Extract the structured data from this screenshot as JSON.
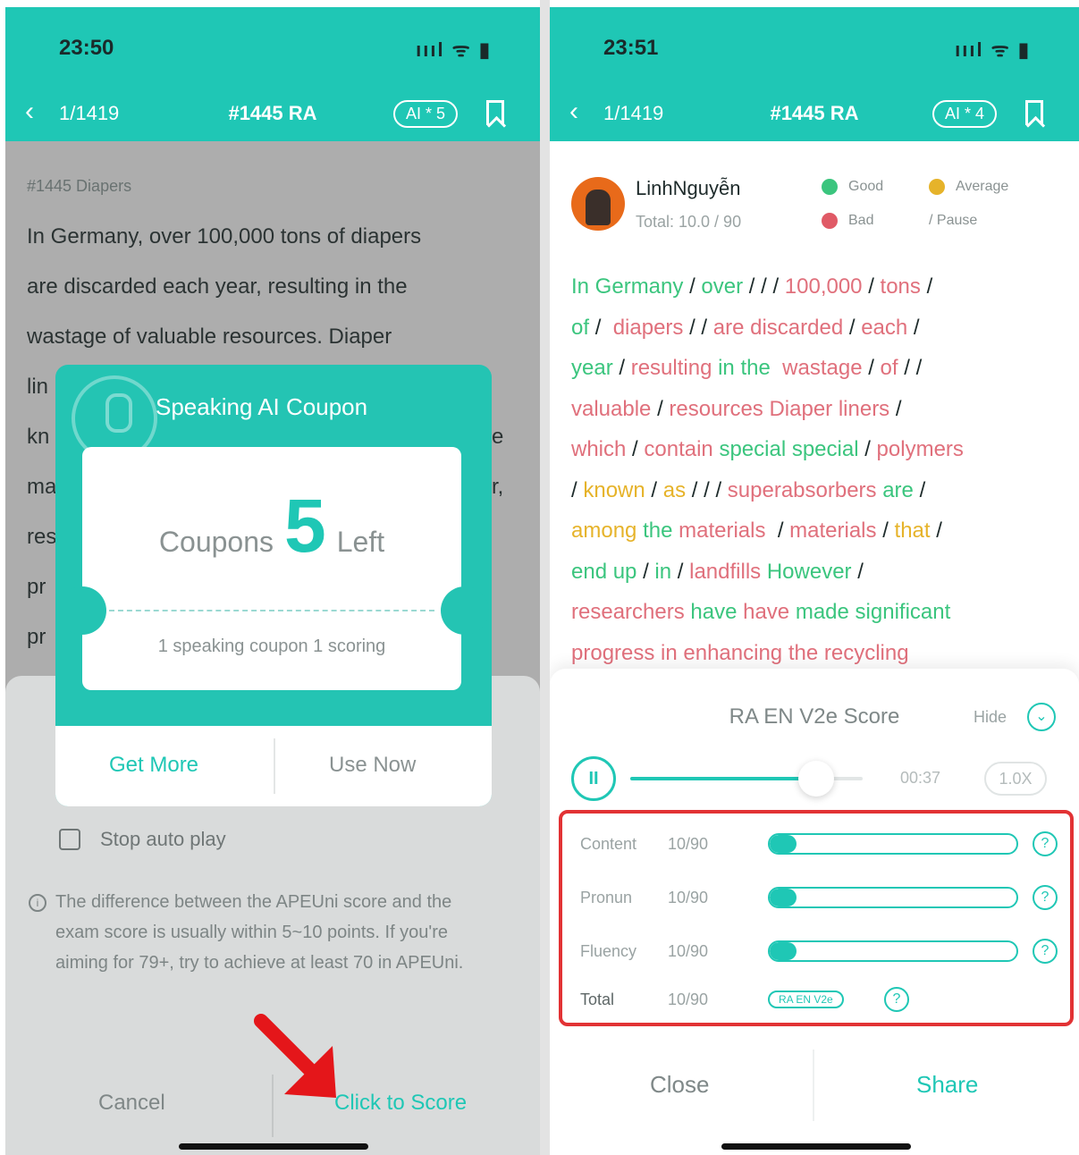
{
  "left": {
    "status": {
      "time": "23:50",
      "icons": "ıııl ᯤ ▮"
    },
    "nav": {
      "pager": "1/1419",
      "title": "#1445 RA",
      "ai_badge": "AI * 5"
    },
    "passage_title": "#1445 Diapers",
    "passage_lines": [
      "In Germany, over 100,000 tons of diapers",
      "are discarded each year, resulting in the",
      "wastage of valuable resources. Diaper",
      "lin",
      "kn",
      "ma",
      "res",
      "pr",
      "pr"
    ],
    "passage_right_fragments": [
      "e",
      "r,"
    ],
    "coupon": {
      "title": "Speaking AI Coupon",
      "prefix": "Coupons",
      "count": "5",
      "suffix": "Left",
      "description": "1 speaking coupon 1 scoring",
      "get_more": "Get More",
      "use_now": "Use Now"
    },
    "sheet": {
      "stop_auto_play": "Stop auto play",
      "tip": "The difference between the APEUni score and the exam score is usually within 5~10 points. If you're aiming for 79+, try to achieve at least 70 in APEUni.",
      "cancel": "Cancel",
      "click_to_score": "Click to Score"
    }
  },
  "right": {
    "status": {
      "time": "23:51",
      "icons": "ıııl ᯤ ▮"
    },
    "nav": {
      "pager": "1/1419",
      "title": "#1445 RA",
      "ai_badge": "AI * 4"
    },
    "user": {
      "name": "LinhNguyễn",
      "total": "Total: 10.0 / 90"
    },
    "legend": {
      "good": "Good",
      "average": "Average",
      "bad": "Bad",
      "pause": "/ Pause"
    },
    "score": {
      "title": "RA EN V2e Score",
      "hide": "Hide",
      "time": "00:37",
      "speed": "1.0X",
      "progress": 0.8,
      "rows": [
        {
          "label": "Content",
          "value": "10/90",
          "fraction": 0.11
        },
        {
          "label": "Pronun",
          "value": "10/90",
          "fraction": 0.11
        },
        {
          "label": "Fluency",
          "value": "10/90",
          "fraction": 0.11
        }
      ],
      "total_label": "Total",
      "total_value": "10/90",
      "version_badge": "RA EN V2e",
      "close": "Close",
      "share": "Share"
    }
  },
  "colors": {
    "accent": "#1fc7b5",
    "good": "#3bc57e",
    "average": "#e6b32a",
    "bad": "#e05a66",
    "highlight_box": "#e23234",
    "arrow": "#e4161a"
  }
}
